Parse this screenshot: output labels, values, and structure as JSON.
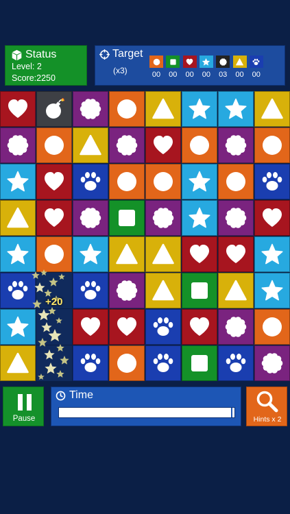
{
  "status": {
    "title": "Status",
    "level": "Level: 2",
    "score": "Score:2250"
  },
  "target": {
    "title": "Target",
    "multiplier": "(x3)",
    "items": [
      {
        "shape": "circle",
        "color": "#e2661a",
        "count": "00"
      },
      {
        "shape": "square",
        "color": "#149128",
        "count": "00"
      },
      {
        "shape": "heart",
        "color": "#a7151f",
        "count": "00"
      },
      {
        "shape": "star",
        "color": "#27a9e0",
        "count": "00"
      },
      {
        "shape": "flower",
        "color": "#222222",
        "count": "03"
      },
      {
        "shape": "triangle",
        "color": "#d8b10a",
        "count": "00"
      },
      {
        "shape": "paw",
        "color": "#1a3eb0",
        "count": "00"
      }
    ]
  },
  "colors": {
    "circle": "#e2661a",
    "square": "#149128",
    "heart": "#a7151f",
    "star": "#27a9e0",
    "flower": "#7a237f",
    "triangle": "#d8b10a",
    "paw": "#1a3eb0",
    "bomb": "#3e4045",
    "empty": "#102a5c"
  },
  "board": [
    [
      "heart",
      "bomb",
      "flower",
      "circle",
      "triangle",
      "star",
      "star",
      "triangle"
    ],
    [
      "flower",
      "circle",
      "triangle",
      "flower",
      "heart",
      "circle",
      "flower",
      "circle"
    ],
    [
      "star",
      "heart",
      "paw",
      "circle",
      "circle",
      "star",
      "circle",
      "paw"
    ],
    [
      "triangle",
      "heart",
      "flower",
      "square",
      "flower",
      "star",
      "flower",
      "heart"
    ],
    [
      "star",
      "circle",
      "star",
      "triangle",
      "triangle",
      "heart",
      "heart",
      "star"
    ],
    [
      "paw",
      "empty",
      "paw",
      "flower",
      "triangle",
      "square",
      "triangle",
      "star"
    ],
    [
      "star",
      "empty",
      "heart",
      "heart",
      "paw",
      "heart",
      "flower",
      "circle"
    ],
    [
      "triangle",
      "empty",
      "paw",
      "circle",
      "paw",
      "square",
      "paw",
      "flower"
    ]
  ],
  "effect": {
    "bonus": "+20"
  },
  "controls": {
    "pause_label": "Pause",
    "time_title": "Time",
    "time_progress": 0.99,
    "hints_label": "Hints x 2"
  }
}
